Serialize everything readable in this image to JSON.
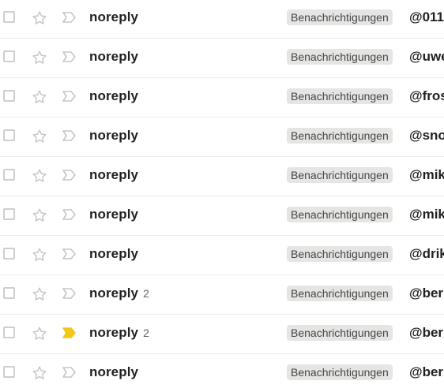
{
  "rows": [
    {
      "sender": "noreply",
      "count": "",
      "label": "Benachrichtigungen",
      "subject": "@011",
      "important": false
    },
    {
      "sender": "noreply",
      "count": "",
      "label": "Benachrichtigungen",
      "subject": "@uwe",
      "important": false
    },
    {
      "sender": "noreply",
      "count": "",
      "label": "Benachrichtigungen",
      "subject": "@fros",
      "important": false
    },
    {
      "sender": "noreply",
      "count": "",
      "label": "Benachrichtigungen",
      "subject": "@sno",
      "important": false
    },
    {
      "sender": "noreply",
      "count": "",
      "label": "Benachrichtigungen",
      "subject": "@mik",
      "important": false
    },
    {
      "sender": "noreply",
      "count": "",
      "label": "Benachrichtigungen",
      "subject": "@mik",
      "important": false
    },
    {
      "sender": "noreply",
      "count": "",
      "label": "Benachrichtigungen",
      "subject": "@drik",
      "important": false
    },
    {
      "sender": "noreply",
      "count": "2",
      "label": "Benachrichtigungen",
      "subject": "@ber",
      "important": false
    },
    {
      "sender": "noreply",
      "count": "2",
      "label": "Benachrichtigungen",
      "subject": "@ber",
      "important": true
    },
    {
      "sender": "noreply",
      "count": "",
      "label": "Benachrichtigungen",
      "subject": "@ber",
      "important": false
    }
  ],
  "icons": {
    "checkbox": "checkbox-icon",
    "star": "star-outline-icon",
    "important_off": "important-marker-outline-icon",
    "important_on": "important-marker-filled-icon"
  },
  "colors": {
    "important_on": "#f5c518",
    "icon_outline": "#c4c7c5",
    "label_chip_bg": "#e5e5e3",
    "label_chip_text": "#444746",
    "text_primary": "#202124",
    "divider": "#ececec"
  }
}
